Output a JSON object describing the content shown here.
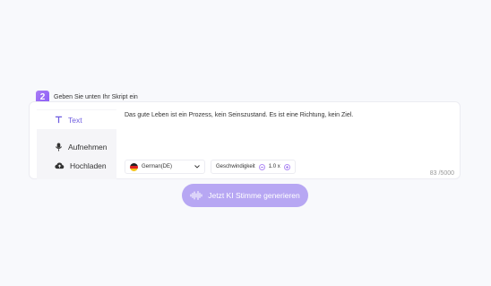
{
  "step": {
    "number": "2",
    "label": "Geben Sie unten Ihr Skript ein"
  },
  "tabs": [
    {
      "label": "Text",
      "icon": "text-icon",
      "active": true
    },
    {
      "label": "Aufnehmen",
      "icon": "microphone-icon",
      "active": false
    },
    {
      "label": "Hochladen",
      "icon": "cloud-upload-icon",
      "active": false
    }
  ],
  "script": {
    "text": "Das gute Leben ist ein Prozess, kein Seinszustand. Es ist eine Richtung, kein Ziel."
  },
  "language": {
    "value": "German(DE)",
    "flag": "de-flag-icon"
  },
  "speed": {
    "label": "Geschwindigkeit",
    "value": "1.0 x"
  },
  "char_count": "83 /5000",
  "generate_button": {
    "label": "Jetzt KI Stimme generieren"
  },
  "colors": {
    "accent": "#8b5cf6",
    "button": "#b7a7f3"
  }
}
